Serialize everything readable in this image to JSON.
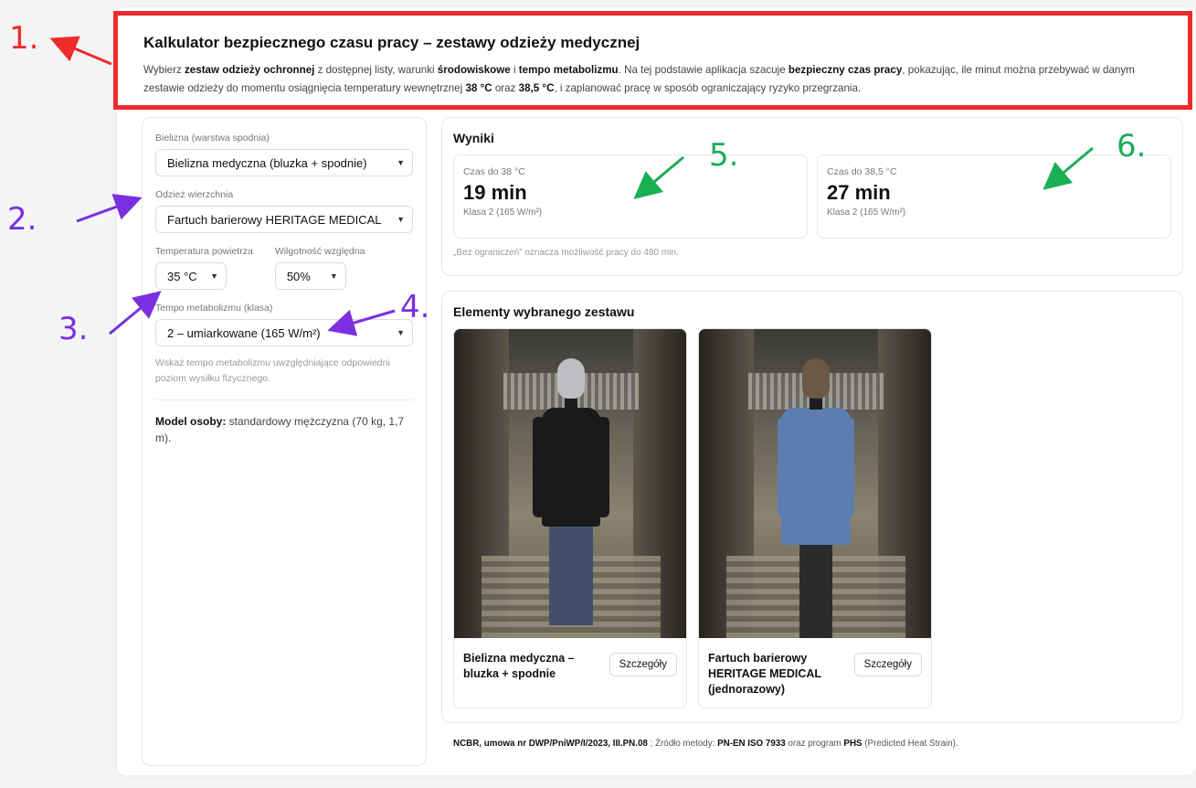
{
  "header": {
    "title": "Kalkulator bezpiecznego czasu pracy – zestawy odzieży medycznej",
    "desc": {
      "p1": "Wybierz ",
      "b1": "zestaw odzieży ochronnej",
      "p2": " z dostępnej listy, warunki ",
      "b2": "środowiskowe",
      "p3": " i ",
      "b3": "tempo metabolizmu",
      "p4": ". Na tej podstawie aplikacja szacuje ",
      "b4": "bezpieczny czas pracy",
      "p5": ", pokazując, ile minut można przebywać w danym zestawie odzieży do momentu osiągnięcia temperatury wewnętrznej ",
      "b5": "38 °C",
      "p6": " oraz ",
      "b6": "38,5 °C",
      "p7": ", i zaplanować pracę w sposób ograniczający ryzyko przegrzania."
    }
  },
  "form": {
    "underwear_label": "Bielizna (warstwa spodnia)",
    "underwear_value": "Bielizna medyczna (bluzka + spodnie)",
    "outer_label": "Odzież wierzchnia",
    "outer_value": "Fartuch barierowy HERITAGE MEDICAL",
    "temp_label": "Temperatura powietrza",
    "temp_value": "35 °C",
    "humidity_label": "Wilgotność względna",
    "humidity_value": "50%",
    "metabolism_label": "Tempo metabolizmu (klasa)",
    "metabolism_value": "2 – umiarkowane (165 W/m²)",
    "hint": "Wskaż tempo metabolizmu uwzględniające odpowiedni poziom wysiłku fizycznego.",
    "model_label": "Model osoby:",
    "model_value": " standardowy mężczyzna (70 kg, 1,7 m)."
  },
  "results": {
    "title": "Wyniki",
    "box1": {
      "caption": "Czas do 38 °C",
      "value": "19 min",
      "class": "Klasa 2 (165 W/m²)"
    },
    "box2": {
      "caption": "Czas do 38,5 °C",
      "value": "27 min",
      "class": "Klasa 2 (165 W/m²)"
    },
    "note": "„Bez ograniczeń” oznacza możliwość pracy do 480 min."
  },
  "elements": {
    "title": "Elementy wybranego zestawu",
    "items": [
      {
        "name": "Bielizna medyczna – bluzka + spodnie",
        "button": "Szczegóły"
      },
      {
        "name": "Fartuch barierowy HERITAGE MEDICAL (jednorazowy)",
        "button": "Szczegóły"
      }
    ]
  },
  "footer": {
    "b1": "NCBR, umowa nr DWP/PniWP/I/2023, III.PN.08",
    "p1": " ; Źródło metody: ",
    "b2": "PN-EN ISO 7933",
    "p2": " oraz program ",
    "b3": "PHS",
    "p3": " (Predicted Heat Strain)."
  },
  "annotations": [
    "1.",
    "2.",
    "3.",
    "4.",
    "5.",
    "6."
  ],
  "colors": {
    "red": "#ee2b2b",
    "purple": "#7b2fe0",
    "green": "#1aae55"
  }
}
